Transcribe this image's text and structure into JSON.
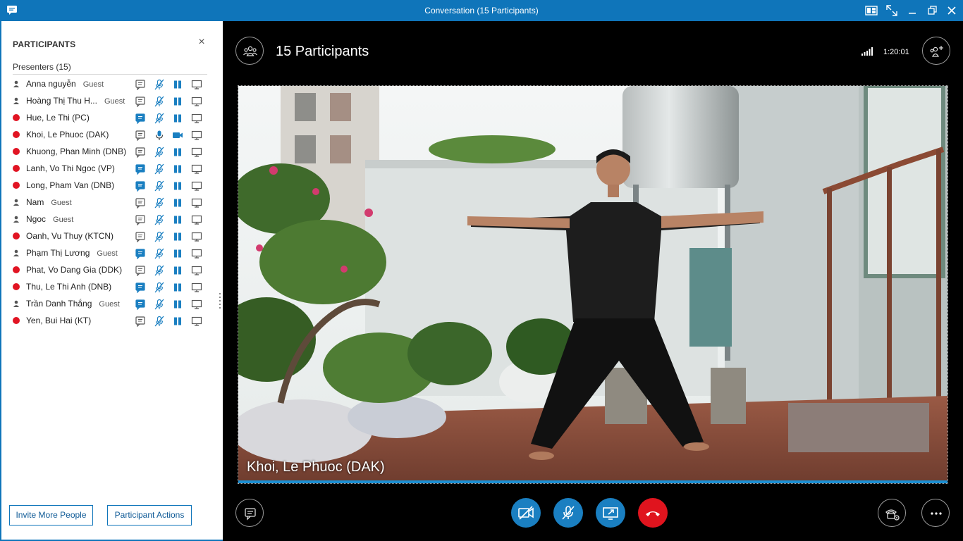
{
  "window": {
    "title": "Conversation (15 Participants)"
  },
  "panel": {
    "header": "PARTICIPANTS",
    "close": "×",
    "group": "Presenters (15)",
    "participants": [
      {
        "name": "Anna nguyễn",
        "tag": "Guest",
        "status": "guest",
        "chat": false,
        "mic": "muted",
        "video": "paused"
      },
      {
        "name": "Hoàng Thị Thu H...",
        "tag": "Guest",
        "status": "guest",
        "chat": false,
        "mic": "muted",
        "video": "paused"
      },
      {
        "name": "Hue, Le Thi (PC)",
        "tag": "",
        "status": "busy",
        "chat": true,
        "mic": "muted",
        "video": "paused"
      },
      {
        "name": "Khoi, Le Phuoc (DAK)",
        "tag": "",
        "status": "busy",
        "chat": false,
        "mic": "active",
        "video": "on"
      },
      {
        "name": "Khuong, Phan Minh (DNB)",
        "tag": "",
        "status": "busy",
        "chat": false,
        "mic": "muted",
        "video": "paused"
      },
      {
        "name": "Lanh, Vo Thi Ngoc (VP)",
        "tag": "",
        "status": "busy",
        "chat": true,
        "mic": "muted",
        "video": "paused"
      },
      {
        "name": "Long, Pham Van (DNB)",
        "tag": "",
        "status": "busy",
        "chat": true,
        "mic": "muted",
        "video": "paused"
      },
      {
        "name": "Nam",
        "tag": "Guest",
        "status": "guest",
        "chat": false,
        "mic": "muted",
        "video": "paused"
      },
      {
        "name": "Ngoc",
        "tag": "Guest",
        "status": "guest",
        "chat": false,
        "mic": "muted",
        "video": "paused"
      },
      {
        "name": "Oanh, Vu Thuy (KTCN)",
        "tag": "",
        "status": "busy",
        "chat": false,
        "mic": "muted",
        "video": "paused"
      },
      {
        "name": "Phạm Thị Lương",
        "tag": "Guest",
        "status": "guest",
        "chat": true,
        "mic": "muted",
        "video": "paused"
      },
      {
        "name": "Phat, Vo Dang Gia (DDK)",
        "tag": "",
        "status": "busy",
        "chat": false,
        "mic": "muted",
        "video": "paused"
      },
      {
        "name": "Thu, Le Thi Anh (DNB)",
        "tag": "",
        "status": "busy",
        "chat": true,
        "mic": "muted",
        "video": "paused"
      },
      {
        "name": "Trần Danh Thắng",
        "tag": "Guest",
        "status": "guest",
        "chat": true,
        "mic": "muted",
        "video": "paused"
      },
      {
        "name": "Yen, Bui Hai (KT)",
        "tag": "",
        "status": "busy",
        "chat": false,
        "mic": "muted",
        "video": "paused"
      }
    ],
    "invite_button": "Invite More People",
    "actions_button": "Participant Actions"
  },
  "main": {
    "title": "15 Participants",
    "timer": "1:20:01",
    "video_label": "Khoi, Le Phuoc (DAK)"
  },
  "colors": {
    "brand": "#0f75ba",
    "busy": "#e11423",
    "control_blue": "#1a7fc1",
    "hangup": "#e0141e",
    "chat_active": "#1a7fc1"
  }
}
